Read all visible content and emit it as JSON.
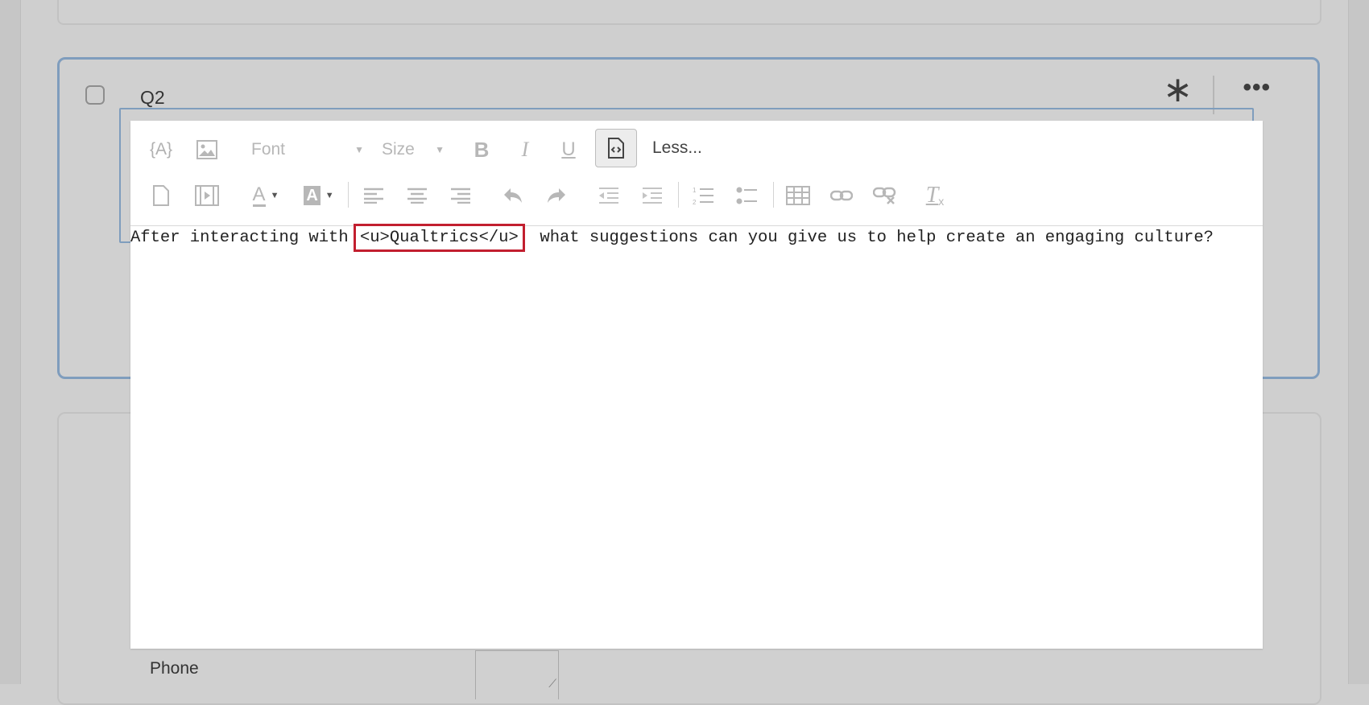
{
  "question": {
    "label": "Q2"
  },
  "toolbar": {
    "font_label": "Font",
    "size_label": "Size",
    "less_label": "Less..."
  },
  "editor": {
    "text_before": "After interacting with ",
    "highlighted": "<u>Qualtrics</u>",
    "text_after": "  what suggestions can you give us to help create an engaging culture?"
  },
  "next_question": {
    "field_label": "Phone"
  },
  "colors": {
    "selection_border": "#7f9dbd",
    "highlight_box": "#c21f2f",
    "toolbar_icon_disabled": "#b7b7b7"
  },
  "icons": [
    "piped-text-icon",
    "image-icon",
    "bold-icon",
    "italic-icon",
    "underline-icon",
    "source-code-icon",
    "document-icon",
    "video-icon",
    "font-color-icon",
    "background-color-icon",
    "align-left-icon",
    "align-center-icon",
    "align-right-icon",
    "undo-icon",
    "redo-icon",
    "outdent-icon",
    "indent-icon",
    "numbered-list-icon",
    "bulleted-list-icon",
    "table-icon",
    "link-icon",
    "unlink-icon",
    "clear-formatting-icon",
    "required-star-icon",
    "more-options-icon"
  ]
}
